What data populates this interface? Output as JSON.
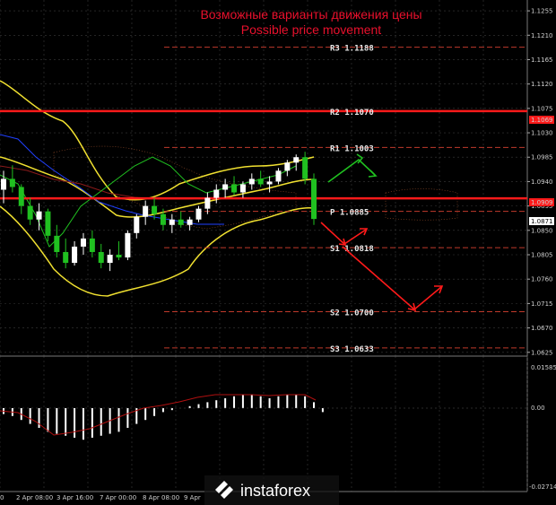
{
  "title": {
    "line1": "Возможные варианты движения цены",
    "line2": "Possible price movement"
  },
  "colors": {
    "background": "#000000",
    "grid": "#3a3a3a",
    "title": "#e8112d",
    "level_solid": "#ff1a1a",
    "level_dashed": "#c0392b",
    "bollinger": "#f0e030",
    "kijun": "#8b1a1a",
    "tenkan": "#2040ff",
    "chikou": "#20c020",
    "candle_bull": "#ffffff",
    "candle_bear": "#20c020",
    "arrow_up": "#20c020",
    "arrow_down": "#ff1a1a",
    "macd_hist": "#ffffff",
    "macd_signal": "#b01010"
  },
  "levels": [
    {
      "name": "R3",
      "value": "1.1188",
      "label": "R3  1.1188",
      "style": "dashed"
    },
    {
      "name": "R2",
      "value": "1.1070",
      "label": "R2  1.1070",
      "style": "solid"
    },
    {
      "name": "R1",
      "value": "1.1003",
      "label": "R1  1.1003",
      "style": "dashed"
    },
    {
      "name": "P",
      "value": "1.0885",
      "label": "P  1.0885",
      "style": "dashed"
    },
    {
      "name": "S1",
      "value": "1.0818",
      "label": "S1  1.0818",
      "style": "dashed"
    },
    {
      "name": "S2",
      "value": "1.0700",
      "label": "S2  1.0700",
      "style": "dashed"
    },
    {
      "name": "S3",
      "value": "1.0633",
      "label": "S3  1.0633",
      "style": "dashed"
    }
  ],
  "price_axis": {
    "ticks": [
      "1.1255",
      "1.1210",
      "1.1165",
      "1.1120",
      "1.1075",
      "1.1030",
      "1.0985",
      "1.0940",
      "1.0895",
      "1.0850",
      "1.0805",
      "1.0760",
      "1.0715",
      "1.0670",
      "1.0625"
    ],
    "marker_upper": "1.1069",
    "marker_mid": "1.0909",
    "marker_current": "1.0871"
  },
  "macd_axis": {
    "ticks": [
      "0.01585",
      "0.00",
      "-0.02714"
    ]
  },
  "time_axis": {
    "labels": [
      "0",
      "2 Apr 08:00",
      "3 Apr 16:00",
      "7 Apr 00:00",
      "8 Apr 08:00",
      "9 Apr"
    ]
  },
  "watermark": {
    "text": "instaforex",
    "icon": "instaforex-logo-icon"
  },
  "chart_data": {
    "type": "candlestick",
    "symbol": "",
    "horizontal_levels": [
      1.1188,
      1.107,
      1.1003,
      1.0885,
      1.0818,
      1.07,
      1.0633
    ],
    "current_price": 1.0871,
    "ylim": [
      1.0618,
      1.1275
    ],
    "candles": [
      {
        "o": 1.0925,
        "h": 1.096,
        "l": 1.09,
        "c": 1.0945
      },
      {
        "o": 1.0945,
        "h": 1.097,
        "l": 1.092,
        "c": 1.093
      },
      {
        "o": 1.093,
        "h": 1.0935,
        "l": 1.088,
        "c": 1.0895
      },
      {
        "o": 1.0895,
        "h": 1.091,
        "l": 1.086,
        "c": 1.087
      },
      {
        "o": 1.087,
        "h": 1.09,
        "l": 1.085,
        "c": 1.0885
      },
      {
        "o": 1.0885,
        "h": 1.089,
        "l": 1.083,
        "c": 1.084
      },
      {
        "o": 1.084,
        "h": 1.086,
        "l": 1.08,
        "c": 1.081
      },
      {
        "o": 1.081,
        "h": 1.0835,
        "l": 1.078,
        "c": 1.079
      },
      {
        "o": 1.079,
        "h": 1.083,
        "l": 1.0785,
        "c": 1.082
      },
      {
        "o": 1.082,
        "h": 1.0845,
        "l": 1.0805,
        "c": 1.0835
      },
      {
        "o": 1.0835,
        "h": 1.085,
        "l": 1.08,
        "c": 1.081
      },
      {
        "o": 1.081,
        "h": 1.0825,
        "l": 1.078,
        "c": 1.079
      },
      {
        "o": 1.079,
        "h": 1.0815,
        "l": 1.0775,
        "c": 1.0805
      },
      {
        "o": 1.0805,
        "h": 1.083,
        "l": 1.0795,
        "c": 1.08
      },
      {
        "o": 1.08,
        "h": 1.085,
        "l": 1.0795,
        "c": 1.0845
      },
      {
        "o": 1.0845,
        "h": 1.088,
        "l": 1.0835,
        "c": 1.0875
      },
      {
        "o": 1.0875,
        "h": 1.0905,
        "l": 1.086,
        "c": 1.0895
      },
      {
        "o": 1.0895,
        "h": 1.091,
        "l": 1.087,
        "c": 1.088
      },
      {
        "o": 1.088,
        "h": 1.089,
        "l": 1.085,
        "c": 1.086
      },
      {
        "o": 1.086,
        "h": 1.088,
        "l": 1.0845,
        "c": 1.087
      },
      {
        "o": 1.087,
        "h": 1.0885,
        "l": 1.0855,
        "c": 1.086
      },
      {
        "o": 1.086,
        "h": 1.0875,
        "l": 1.085,
        "c": 1.087
      },
      {
        "o": 1.087,
        "h": 1.0895,
        "l": 1.0865,
        "c": 1.089
      },
      {
        "o": 1.089,
        "h": 1.092,
        "l": 1.088,
        "c": 1.091
      },
      {
        "o": 1.091,
        "h": 1.0935,
        "l": 1.09,
        "c": 1.0925
      },
      {
        "o": 1.0925,
        "h": 1.0945,
        "l": 1.091,
        "c": 1.0935
      },
      {
        "o": 1.0935,
        "h": 1.095,
        "l": 1.0915,
        "c": 1.092
      },
      {
        "o": 1.092,
        "h": 1.094,
        "l": 1.091,
        "c": 1.0935
      },
      {
        "o": 1.0935,
        "h": 1.0955,
        "l": 1.0925,
        "c": 1.0945
      },
      {
        "o": 1.0945,
        "h": 1.096,
        "l": 1.093,
        "c": 1.0935
      },
      {
        "o": 1.0935,
        "h": 1.095,
        "l": 1.092,
        "c": 1.094
      },
      {
        "o": 1.094,
        "h": 1.0965,
        "l": 1.0935,
        "c": 1.096
      },
      {
        "o": 1.096,
        "h": 1.098,
        "l": 1.095,
        "c": 1.0975
      },
      {
        "o": 1.0975,
        "h": 1.099,
        "l": 1.096,
        "c": 1.0985
      },
      {
        "o": 1.0985,
        "h": 1.0995,
        "l": 1.0935,
        "c": 1.0945
      },
      {
        "o": 1.0945,
        "h": 1.0955,
        "l": 1.086,
        "c": 1.0871
      }
    ],
    "macd_histogram": [
      -0.003,
      -0.004,
      -0.006,
      -0.008,
      -0.01,
      -0.012,
      -0.013,
      -0.014,
      -0.015,
      -0.016,
      -0.015,
      -0.014,
      -0.013,
      -0.012,
      -0.01,
      -0.008,
      -0.006,
      -0.004,
      -0.002,
      -0.001,
      0.0,
      0.001,
      0.002,
      0.003,
      0.004,
      0.005,
      0.006,
      0.007,
      0.007,
      0.006,
      0.005,
      0.006,
      0.007,
      0.007,
      0.006,
      0.003,
      -0.002
    ]
  }
}
